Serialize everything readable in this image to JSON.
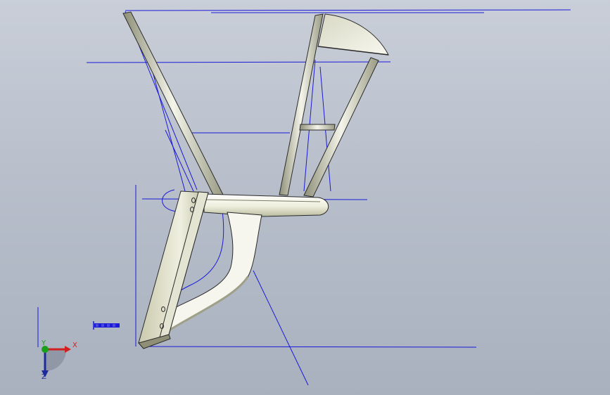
{
  "viewport": {
    "background_top": "#c9ced8",
    "background_bottom": "#a9b1bf",
    "sketch_line_color": "#1a1ad8",
    "part_face_color": "#f6f6ee",
    "part_shade_color": "#b7b89a",
    "edge_color": "#2a2a2a"
  },
  "triad": {
    "x_label": "X",
    "y_label": "Y",
    "z_label": "Z",
    "x_color": "#d22020",
    "y_color": "#18a018",
    "z_color": "#1f2a9a"
  },
  "scale_bar": {
    "icon": "scale-bar-icon"
  }
}
